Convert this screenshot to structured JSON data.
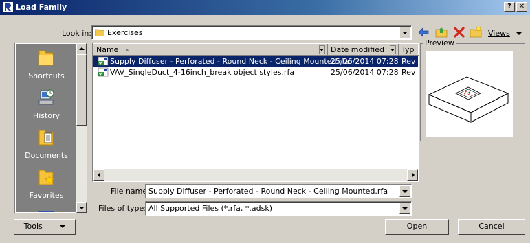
{
  "window": {
    "title": "Load Family",
    "help_label": "?",
    "close_label": "✕"
  },
  "lookin": {
    "label": "Look in:",
    "value": "Exercises"
  },
  "toolbar": {
    "views_label": "Views"
  },
  "places": [
    {
      "label": "Shortcuts",
      "icon": "folder-icon"
    },
    {
      "label": "History",
      "icon": "history-icon"
    },
    {
      "label": "Documents",
      "icon": "documents-icon"
    },
    {
      "label": "Favorites",
      "icon": "favorites-icon"
    }
  ],
  "filelist": {
    "columns": {
      "name": "Name",
      "date": "Date modified",
      "type": "Typ"
    },
    "rows": [
      {
        "name": "Supply Diffuser - Perforated - Round Neck - Ceiling Mounted.rfa",
        "date": "25/06/2014 07:28",
        "type": "Rev",
        "selected": true
      },
      {
        "name": "VAV_SingleDuct_4-16inch_break object styles.rfa",
        "date": "25/06/2014 07:28",
        "type": "Rev",
        "selected": false
      }
    ]
  },
  "preview": {
    "label": "Preview"
  },
  "filename": {
    "label": "File name:",
    "value": "Supply Diffuser - Perforated - Round Neck - Ceiling Mounted.rfa"
  },
  "filetype": {
    "label": "Files of type:",
    "value": "All Supported Files  (*.rfa, *.adsk)"
  },
  "buttons": {
    "tools": "Tools",
    "open": "Open",
    "cancel": "Cancel"
  }
}
